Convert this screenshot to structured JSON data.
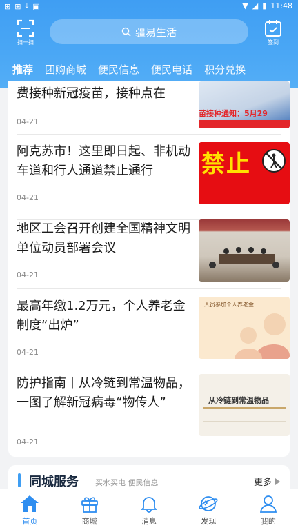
{
  "status": {
    "time": "11:48"
  },
  "header": {
    "scan_label": "扫一扫",
    "search_text": "疆易生活",
    "signin_label": "签到"
  },
  "tabs": [
    "推荐",
    "团购商城",
    "便民信息",
    "便民电话",
    "积分兑换"
  ],
  "news": [
    {
      "title": "费接种新冠疫苗，接种点在",
      "date": "04-21",
      "thumb_text": "苗接种通知：5月29"
    },
    {
      "title": "阿克苏市！这里即日起、非机动车道和行人通道禁止通行",
      "date": "04-21",
      "thumb_text": "禁止"
    },
    {
      "title": "地区工会召开创建全国精神文明单位动员部署会议",
      "date": "04-21",
      "thumb_text": ""
    },
    {
      "title": "最高年缴1.2万元，个人养老金制度“出炉”",
      "date": "04-21",
      "thumb_text": "人员参加个人养老金"
    },
    {
      "title": "防护指南丨从冷链到常温物品，一图了解新冠病毒“物传人”",
      "date": "04-21",
      "thumb_text": "从冷链到常温物品"
    }
  ],
  "service": {
    "title": "同城服务",
    "subtitle": "买水买电 便民信息",
    "more": "更多"
  },
  "nav": [
    {
      "label": "首页",
      "icon": "home-icon"
    },
    {
      "label": "商城",
      "icon": "gift-icon"
    },
    {
      "label": "消息",
      "icon": "bell-icon"
    },
    {
      "label": "发现",
      "icon": "planet-icon"
    },
    {
      "label": "我的",
      "icon": "user-icon"
    }
  ],
  "colors": {
    "primary": "#3f9ef3",
    "active_nav": "#2f8ef0"
  }
}
